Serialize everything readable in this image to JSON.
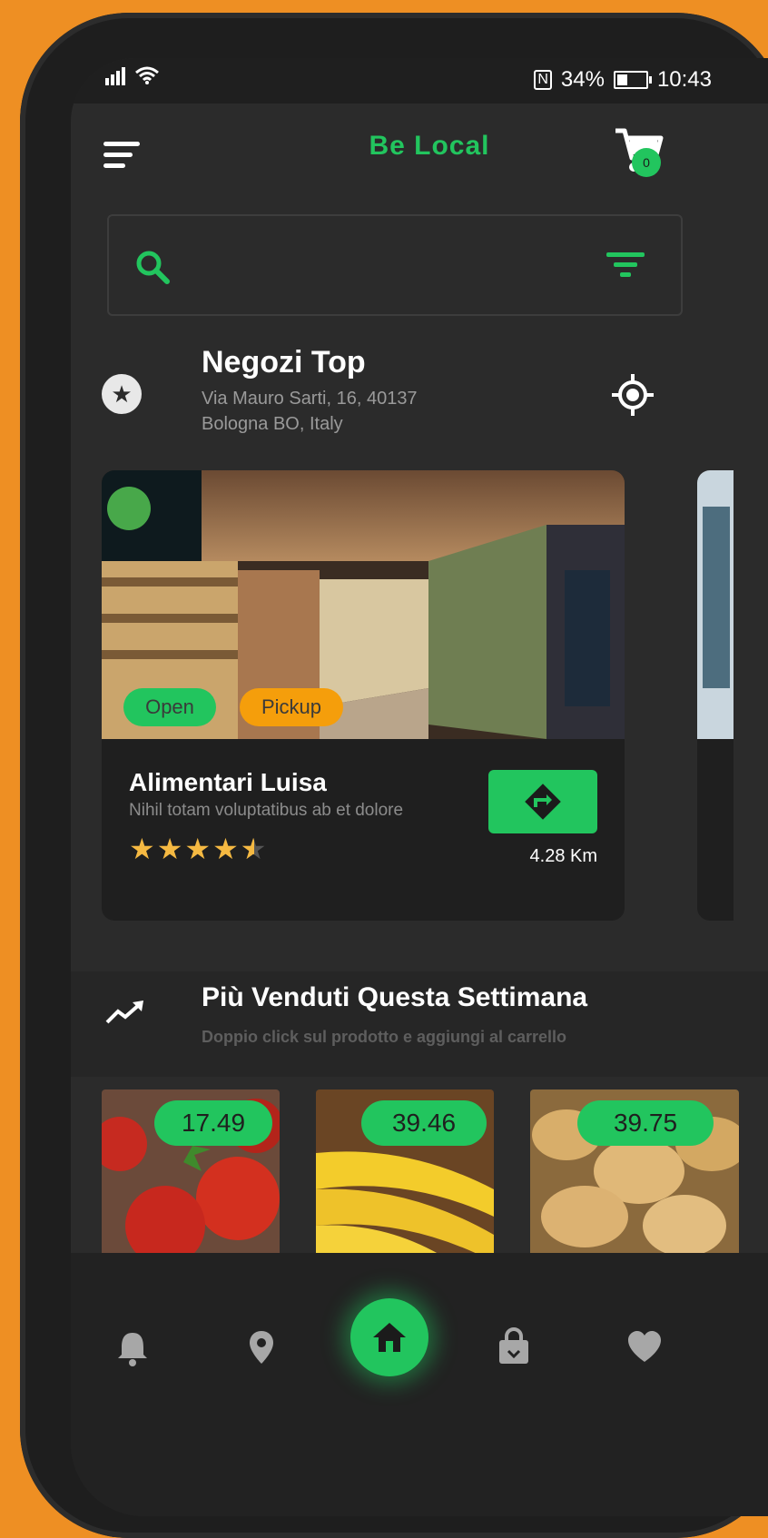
{
  "status_bar": {
    "nfc": "N",
    "battery": "34%",
    "time": "10:43"
  },
  "header": {
    "title": "Be Local",
    "cart_count": "0"
  },
  "search": {
    "placeholder": "",
    "value": ""
  },
  "top_stores": {
    "title": "Negozi Top",
    "address_line1": "Via Mauro Sarti, 16, 40137",
    "address_line2": "Bologna BO, Italy"
  },
  "store_card": {
    "name": "Alimentari Luisa",
    "description": "Nihil totam voluptatibus ab et dolore",
    "badge_open": "Open",
    "badge_pickup": "Pickup",
    "rating": 4.5,
    "rating_max": 5,
    "distance": "4.28 Km"
  },
  "best_sellers": {
    "title": "Più Venduti Questa Settimana",
    "subtitle": "Doppio click sul prodotto e aggiungi al carrello",
    "products": [
      {
        "name": "tomatoes",
        "price": "17.49"
      },
      {
        "name": "bananas",
        "price": "39.46"
      },
      {
        "name": "potatoes",
        "price": "39.75"
      }
    ]
  },
  "tabbar": {
    "items": [
      {
        "icon": "bell-icon"
      },
      {
        "icon": "map-pin-icon"
      },
      {
        "icon": "home-icon",
        "active": true
      },
      {
        "icon": "shopping-bag-icon"
      },
      {
        "icon": "heart-icon"
      }
    ]
  },
  "colors": {
    "accent": "#22c55e",
    "pickup": "#f59e0b",
    "background": "#2b2b2b",
    "frame": "#ee8f23"
  }
}
